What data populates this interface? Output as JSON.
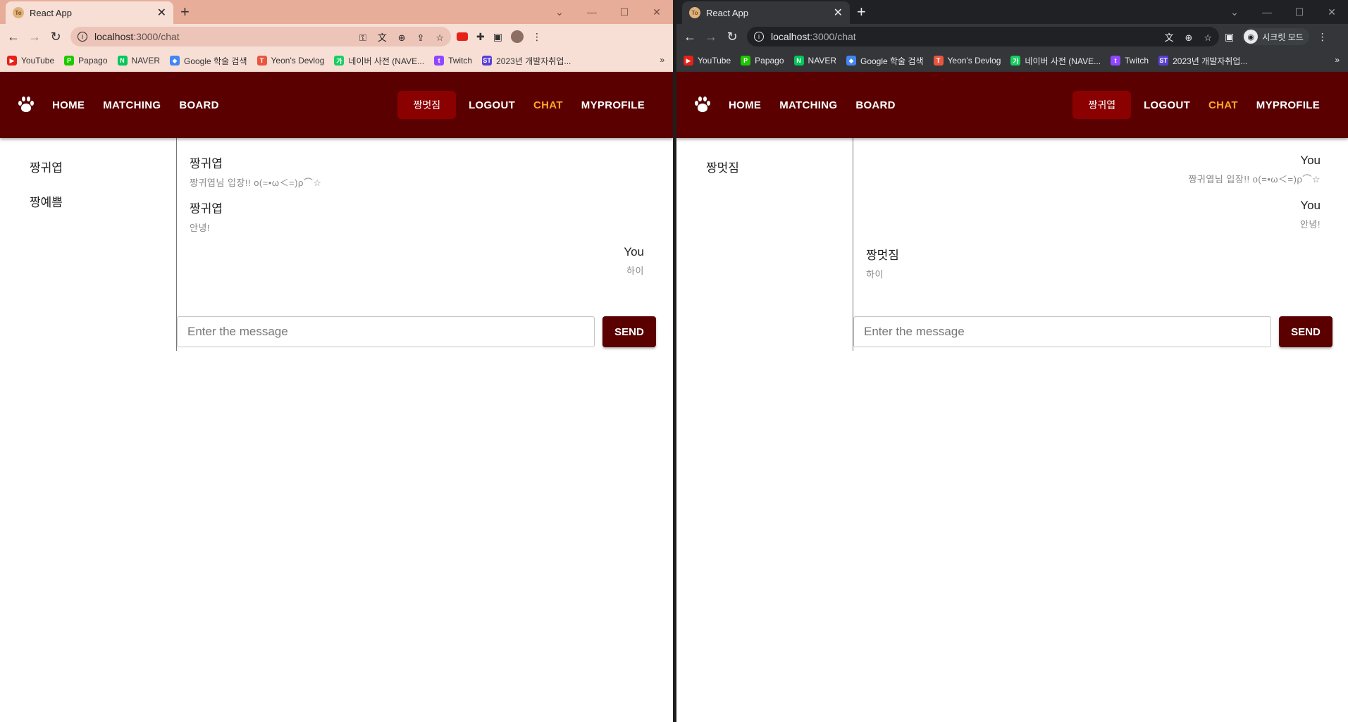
{
  "browser": {
    "tab_title": "React App",
    "favicon_text": "To",
    "url_host": "localhost",
    "url_path": ":3000/chat",
    "incognito_label": "시크릿 모드",
    "bookmarks": [
      {
        "label": "YouTube",
        "color": "#e62117",
        "glyph": "▶"
      },
      {
        "label": "Papago",
        "color": "#1ec800",
        "glyph": "P"
      },
      {
        "label": "NAVER",
        "color": "#03c75a",
        "glyph": "N"
      },
      {
        "label": "Google 학술 검색",
        "color": "#4285f4",
        "glyph": "◆"
      },
      {
        "label": "Yeon's Devlog",
        "color": "#e8563f",
        "glyph": "T"
      },
      {
        "label": "네이버 사전 (NAVE...",
        "color": "#19ce60",
        "glyph": "가"
      },
      {
        "label": "Twitch",
        "color": "#9146ff",
        "glyph": "t"
      },
      {
        "label": "2023년 개발자취업...",
        "color": "#5a3fd6",
        "glyph": "ST"
      }
    ],
    "more_bookmarks": "»"
  },
  "nav": {
    "home": "HOME",
    "matching": "MATCHING",
    "board": "BOARD",
    "logout": "LOGOUT",
    "chat": "CHAT",
    "myprofile": "MYPROFILE"
  },
  "colors": {
    "navbar": "#5a0000",
    "user_pill": "#8b0000",
    "active_nav": "#ffa726",
    "send_button": "#5a0000"
  },
  "left_window": {
    "current_user": "짱멋짐",
    "chat_users": [
      "짱귀엽",
      "짱예쁨"
    ],
    "messages": [
      {
        "sender": "짱귀엽",
        "text": "짱귀엽님 입장!! o(=•ω＜=)ρ⌒☆",
        "mine": false
      },
      {
        "sender": "짱귀엽",
        "text": "안녕!",
        "mine": false
      },
      {
        "sender": "You",
        "text": "하이",
        "mine": true
      }
    ],
    "input_placeholder": "Enter the message",
    "send_label": "SEND"
  },
  "right_window": {
    "current_user": "짱귀엽",
    "chat_users": [
      "짱멋짐"
    ],
    "messages": [
      {
        "sender": "You",
        "text": "짱귀엽님 입장!! o(=•ω＜=)ρ⌒☆",
        "mine": true
      },
      {
        "sender": "You",
        "text": "안녕!",
        "mine": true
      },
      {
        "sender": "짱멋짐",
        "text": "하이",
        "mine": false
      }
    ],
    "input_placeholder": "Enter the message",
    "send_label": "SEND"
  }
}
